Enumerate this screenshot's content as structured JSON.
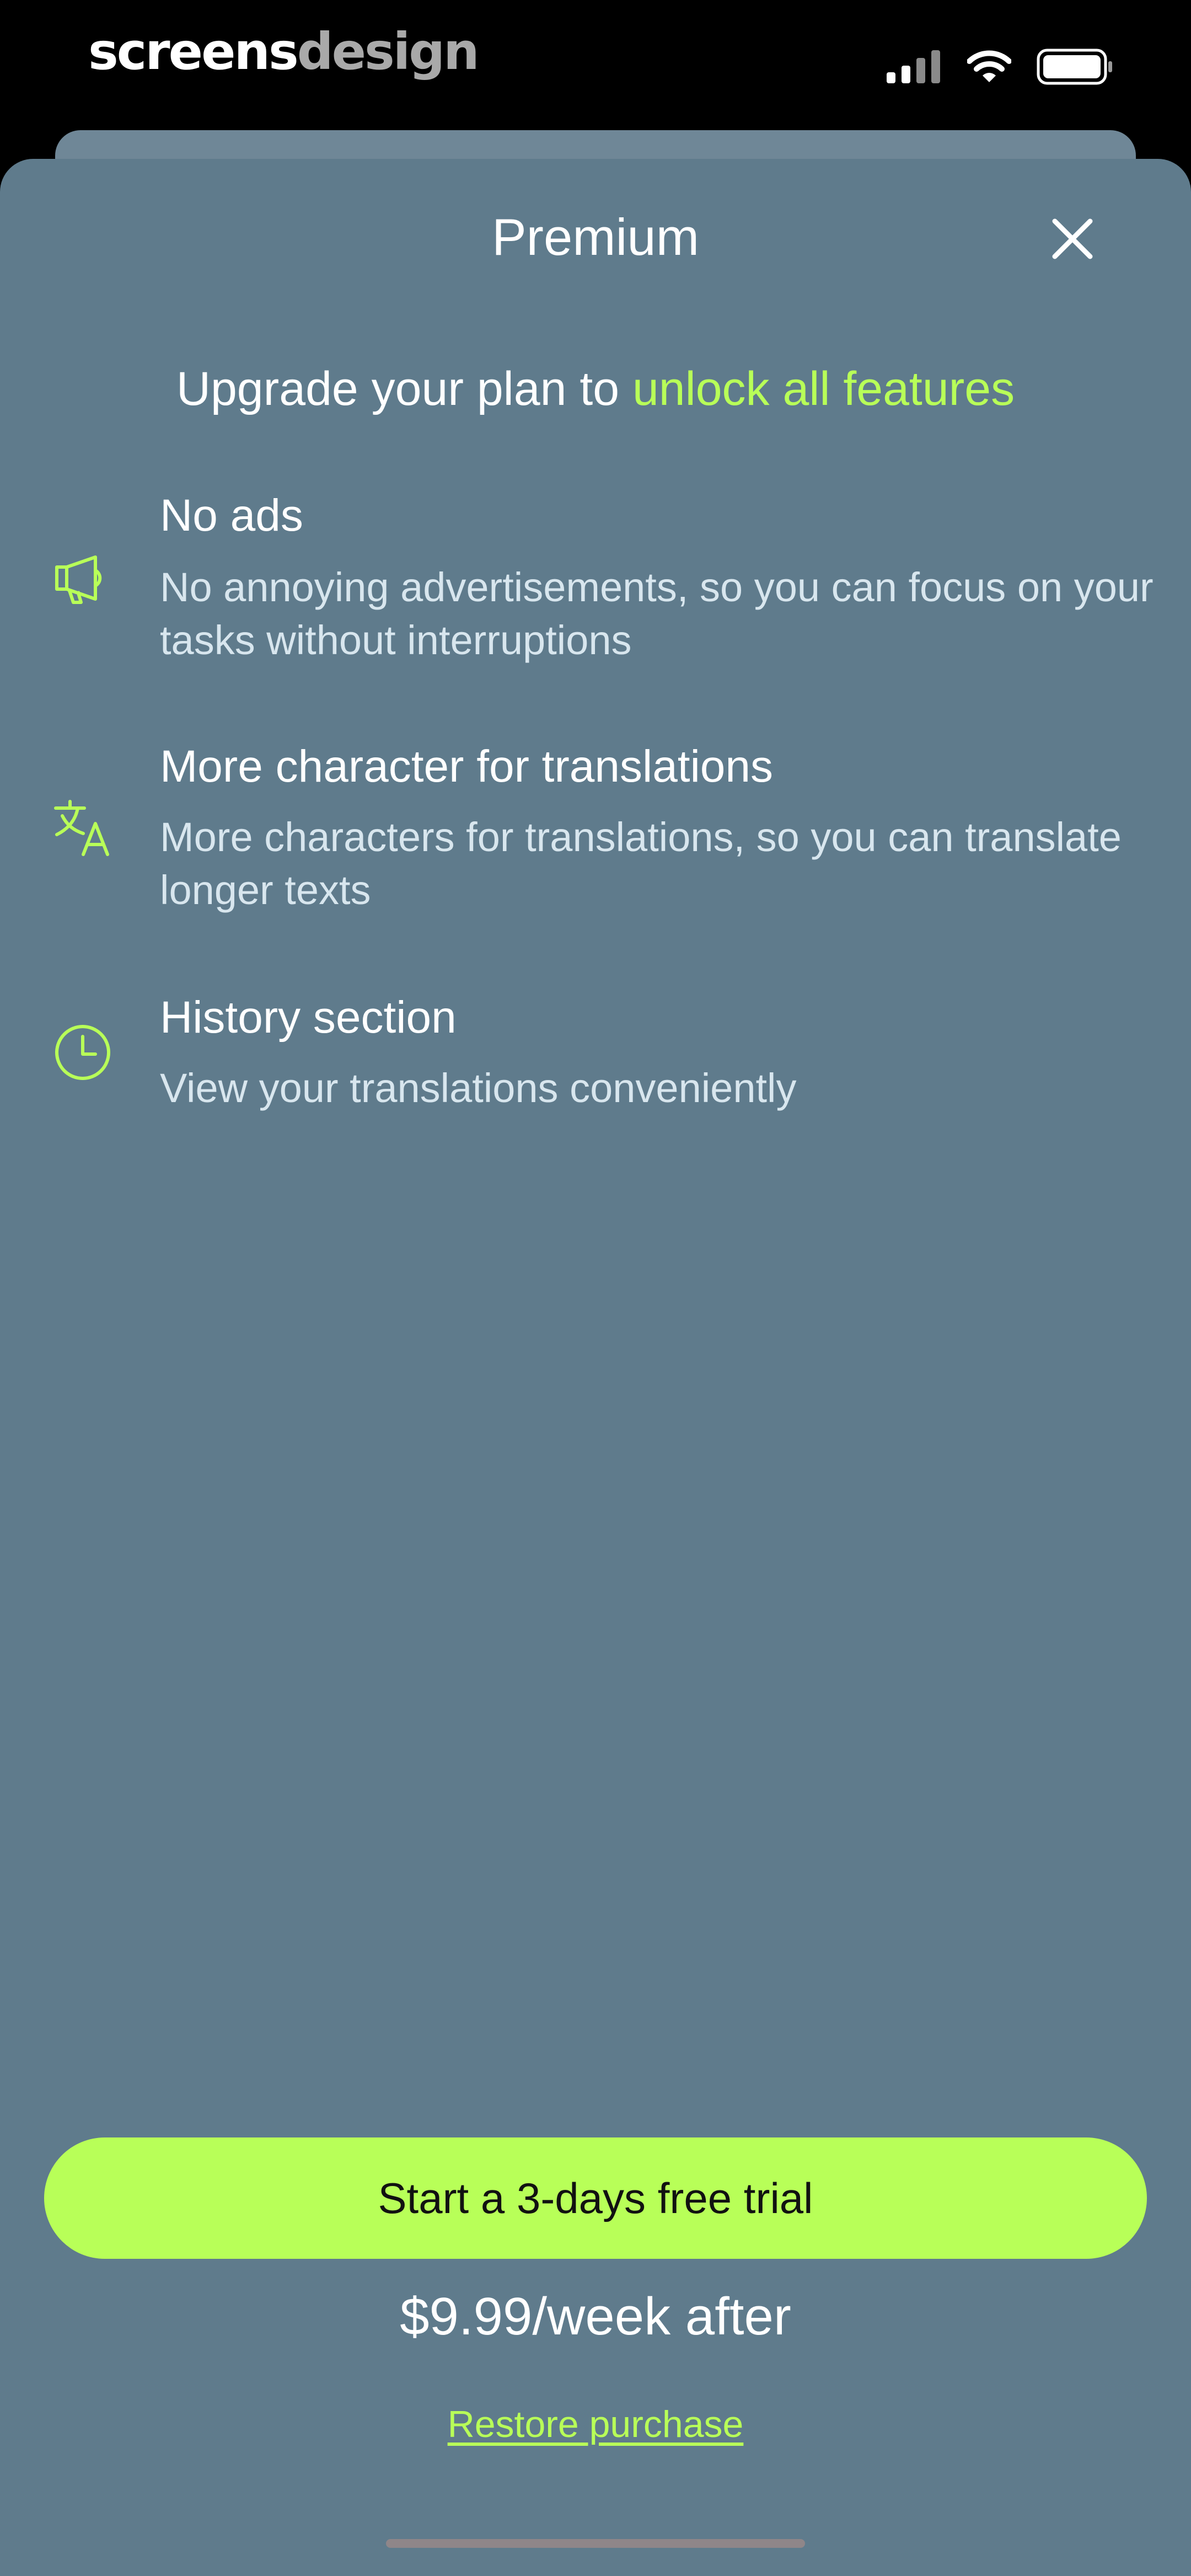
{
  "brand": {
    "part1": "screens",
    "part2": "design"
  },
  "status_bar": {
    "icons": [
      "cellular-signal-icon",
      "wifi-icon",
      "battery-icon"
    ]
  },
  "sheet": {
    "title": "Premium",
    "close_icon": "close-icon"
  },
  "headline": {
    "prefix": "Upgrade your plan to ",
    "accent": "unlock all features"
  },
  "features": [
    {
      "icon": "megaphone-icon",
      "title": "No ads",
      "description": "No annoying advertisements, so you can focus on your tasks without interruptions"
    },
    {
      "icon": "translate-icon",
      "title": "More character for translations",
      "description": "More characters for translations, so you can translate longer texts"
    },
    {
      "icon": "clock-icon",
      "title": "History section",
      "description": "View your translations conveniently"
    }
  ],
  "cta": {
    "label": "Start a 3-days free trial"
  },
  "price": {
    "text": "$9.99/week after"
  },
  "restore": {
    "label": "Restore purchase"
  },
  "colors": {
    "accent": "#b8ff58",
    "sheet_background": "#5f7b8c",
    "status_background": "#000000"
  }
}
